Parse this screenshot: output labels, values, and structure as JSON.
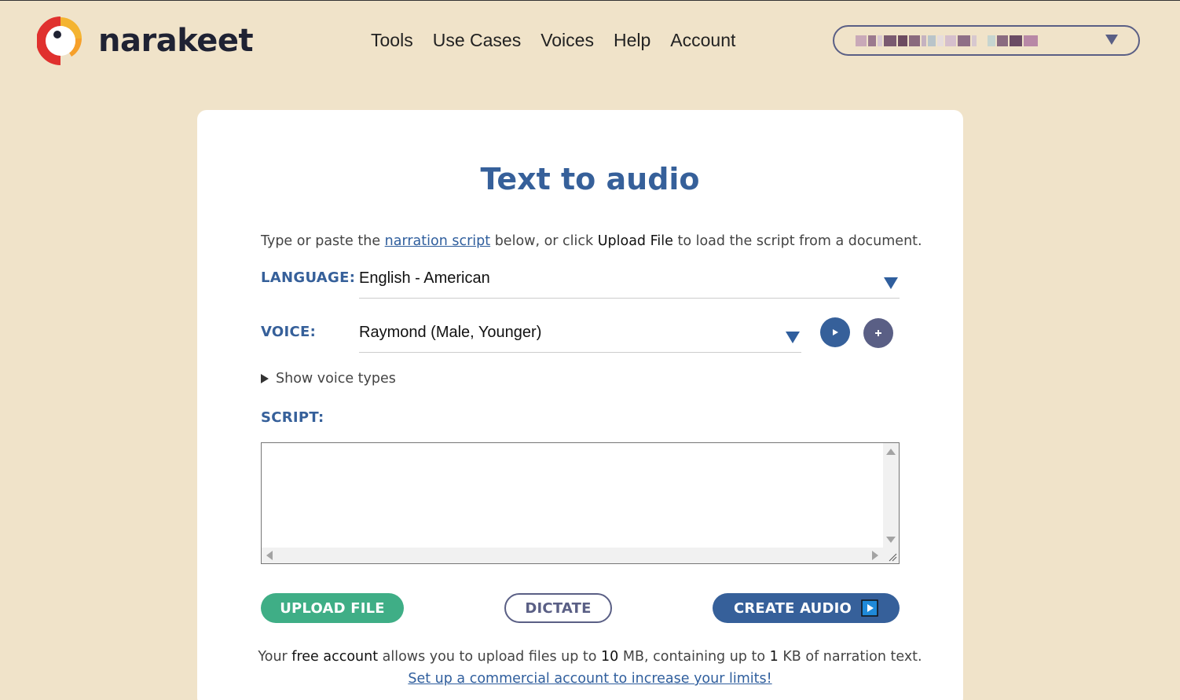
{
  "brand": {
    "name": "narakeet",
    "logo_icon": "parrot-logo-icon",
    "colors": {
      "red": "#e0312e",
      "yellow": "#f4b431",
      "dark": "#1f2233"
    }
  },
  "nav": {
    "items": [
      {
        "label": "Tools"
      },
      {
        "label": "Use Cases"
      },
      {
        "label": "Voices"
      },
      {
        "label": "Help"
      },
      {
        "label": "Account"
      }
    ]
  },
  "user_menu": {
    "value": "",
    "icon": "chevron-down-icon"
  },
  "page": {
    "title": "Text to audio",
    "intro": {
      "part1": "Type or paste the ",
      "link": "narration script",
      "part2": " below, or click ",
      "bold": "Upload File",
      "part3": " to load the script from a document."
    }
  },
  "language": {
    "label": "LANGUAGE:",
    "value": "English - American"
  },
  "voice": {
    "label": "VOICE:",
    "value": "Raymond (Male, Younger)",
    "play_icon": "play-icon",
    "add_icon": "plus-icon"
  },
  "voice_types": {
    "label": "Show voice types"
  },
  "script": {
    "label": "SCRIPT:",
    "value": ""
  },
  "actions": {
    "upload": "UPLOAD FILE",
    "dictate": "DICTATE",
    "create": "CREATE AUDIO",
    "create_icon": "play-icon"
  },
  "limits": {
    "p1": "Your ",
    "b1": "free account",
    "p2": " allows you to upload files up to ",
    "b2": "10",
    "p3": " MB, containing up to ",
    "b3": "1",
    "p4": " KB of narration text.",
    "link": "Set up a commercial account to increase your limits!"
  },
  "theme": {
    "background": "#f0e3c9",
    "primary_blue": "#36609a",
    "green": "#3fae86",
    "purple": "#5a5f85"
  }
}
